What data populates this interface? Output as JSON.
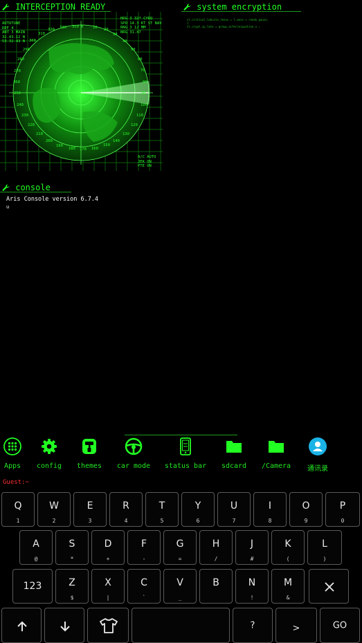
{
  "radar_panel": {
    "title": "INTERCEPTION READY",
    "left_readout": [
      "AUTOTUNE",
      "DEF 4",
      "ANT 3 MAIN",
      "32.43.12 N",
      "53.32.43 N"
    ],
    "right_readout": [
      "HDG 3 32* CYRQ",
      "SPD 14.3 KT ST NAV",
      "RNG 3 12 MM",
      "BRG 31.47"
    ],
    "bottom_readout": [
      "A/C AUTO",
      "JEK ON",
      "PTE ON"
    ],
    "bearings": [
      "350",
      "0",
      "10",
      "20",
      "30",
      "40",
      "50",
      "60",
      "70",
      "80",
      "90",
      "100",
      "110",
      "120",
      "130",
      "140",
      "150",
      "160",
      "170",
      "180",
      "190",
      "200",
      "210",
      "220",
      "230",
      "240",
      "250",
      "260",
      "270",
      "280",
      "290",
      "300",
      "310",
      "320",
      "330",
      "340"
    ]
  },
  "encryption_panel": {
    "title": "system encryption",
    "code_lines": [
      "sl.critical_lakcule_rmsus = l.aess + rando_qauzs;",
      "}",
      "sl.crypt.cp_late = group_aiferceipuation.v ;"
    ]
  },
  "console_panel": {
    "title": "console",
    "lines": [
      "Aris Console version 6.7.4",
      "u"
    ]
  },
  "dock": [
    {
      "label": "Apps",
      "icon": "apps-grid-icon"
    },
    {
      "label": "config",
      "icon": "gear-icon"
    },
    {
      "label": "themes",
      "icon": "paint-roller-icon"
    },
    {
      "label": "car mode",
      "icon": "steering-wheel-icon"
    },
    {
      "label": "status bar",
      "icon": "phone-icon"
    },
    {
      "label": "sdcard",
      "icon": "folder-icon"
    },
    {
      "label": "/Camera",
      "icon": "folder-icon"
    },
    {
      "label": "通讯录",
      "icon": "contact-avatar-icon"
    }
  ],
  "prompt": "Guest:~",
  "keyboard": {
    "row1": [
      [
        "Q",
        "1"
      ],
      [
        "W",
        "2"
      ],
      [
        "E",
        "3"
      ],
      [
        "R",
        "4"
      ],
      [
        "T",
        "5"
      ],
      [
        "Y",
        "6"
      ],
      [
        "U",
        "7"
      ],
      [
        "I",
        "8"
      ],
      [
        "O",
        "9"
      ],
      [
        "P",
        "0"
      ]
    ],
    "row2": [
      [
        "A",
        "@"
      ],
      [
        "S",
        "*"
      ],
      [
        "D",
        "+"
      ],
      [
        "F",
        "-"
      ],
      [
        "G",
        "="
      ],
      [
        "H",
        "/"
      ],
      [
        "J",
        "#"
      ],
      [
        "K",
        "("
      ],
      [
        "L",
        ")"
      ]
    ],
    "row3": [
      [
        "Z",
        "$"
      ],
      [
        "X",
        "|"
      ],
      [
        "C",
        "`"
      ],
      [
        "V",
        "_"
      ],
      [
        "B",
        ""
      ],
      [
        "N",
        "!"
      ],
      [
        "M",
        "&"
      ]
    ],
    "numbers_key": "123",
    "question_key": "?",
    "greater_key": ">",
    "go_key": "GO"
  },
  "colors": {
    "terminal_green": "#22ff22",
    "prompt_red": "#ff3030",
    "accent_cyan": "#1ab3e6"
  }
}
